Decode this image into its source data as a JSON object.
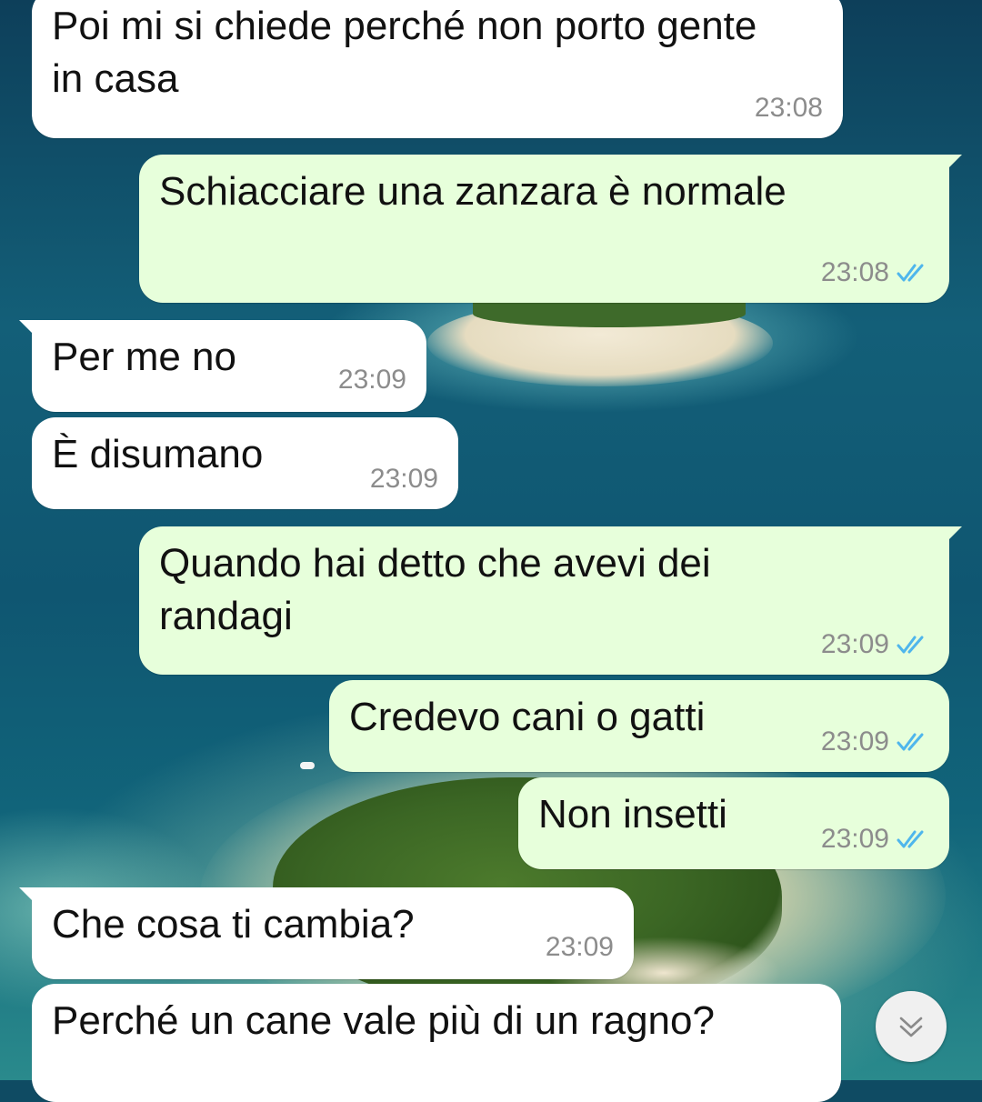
{
  "messages": [
    {
      "direction": "in",
      "text": "Poi mi si chiede perché non porto gente in casa",
      "time": "23:08"
    },
    {
      "direction": "out",
      "text": "Schiacciare una zanzara è normale",
      "time": "23:08",
      "ticks": "read"
    },
    {
      "direction": "in",
      "text": "Per me no",
      "time": "23:09"
    },
    {
      "direction": "in",
      "text": "È disumano",
      "time": "23:09"
    },
    {
      "direction": "out",
      "text": "Quando hai detto che avevi dei randagi",
      "time": "23:09",
      "ticks": "read"
    },
    {
      "direction": "out",
      "text": "Credevo cani o gatti",
      "time": "23:09",
      "ticks": "read"
    },
    {
      "direction": "out",
      "text": "Non insetti",
      "time": "23:09",
      "ticks": "read"
    },
    {
      "direction": "in",
      "text": "Che cosa ti cambia?",
      "time": "23:09"
    },
    {
      "direction": "in",
      "text": "Perché un cane vale più di un ragno?",
      "time": ""
    }
  ],
  "scroll_button": {
    "icon": "double-chevron-down-icon"
  },
  "colors": {
    "incoming_bubble": "#ffffff",
    "outgoing_bubble": "#e7ffdb",
    "read_ticks": "#4fb6ec",
    "timestamp": "#8c8c8c"
  }
}
